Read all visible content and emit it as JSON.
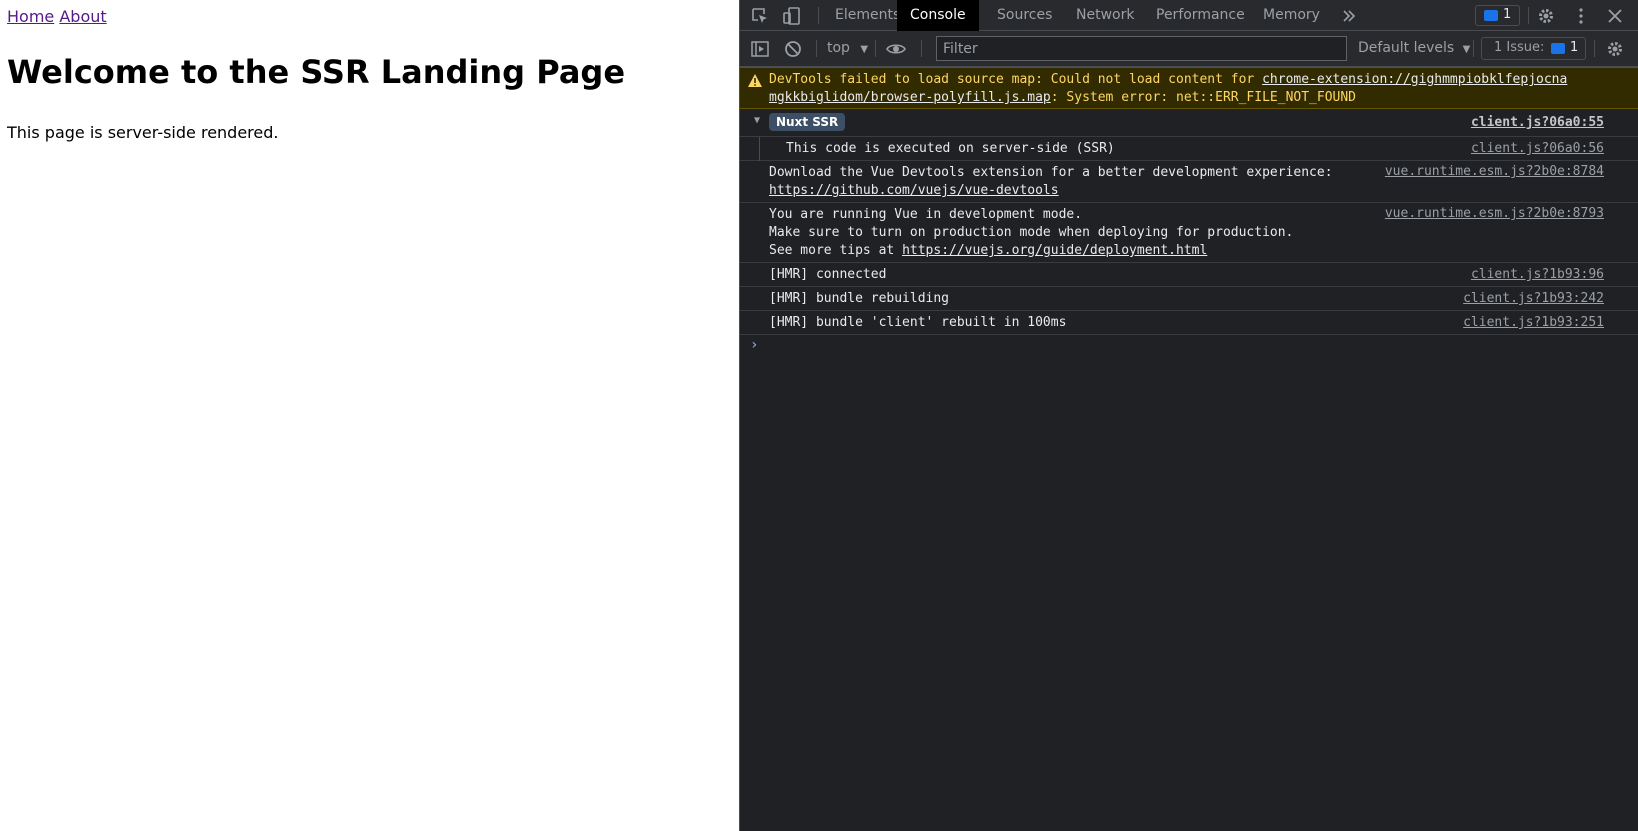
{
  "page": {
    "nav": {
      "home": "Home",
      "about": "About"
    },
    "title": "Welcome to the SSR Landing Page",
    "text": "This page is server-side rendered."
  },
  "devtools": {
    "tabs": [
      "Elements",
      "Console",
      "Sources",
      "Network",
      "Performance",
      "Memory"
    ],
    "active_tab": "Console",
    "issue_count": "1",
    "toolbar": {
      "context": "top",
      "filter_placeholder": "Filter",
      "levels": "Default levels",
      "issues_label": "1 Issue:",
      "issues_count": "1"
    },
    "messages": {
      "warning": {
        "prefix": "DevTools failed to load source map: Could not load content for ",
        "link": "chrome-extension://gighmmpiobklfepjocna\nmgkkbiglidom/browser-polyfill.js.map",
        "suffix": ": System error: net::ERR_FILE_NOT_FOUND"
      },
      "group": {
        "label": "Nuxt SSR",
        "source": "client.js?06a0:55"
      },
      "group_child": {
        "text": "This code is executed on server-side (SSR)",
        "source": "client.js?06a0:56"
      },
      "vue_devtools": {
        "text": "Download the Vue Devtools extension for a better development experience:",
        "link": "https://github.com/vuejs/vue-devtools",
        "source": "vue.runtime.esm.js?2b0e:8784"
      },
      "vue_dev_mode": {
        "line1": "You are running Vue in development mode.",
        "line2": "Make sure to turn on production mode when deploying for production.",
        "line3_prefix": "See more tips at ",
        "link": "https://vuejs.org/guide/deployment.html",
        "source": "vue.runtime.esm.js?2b0e:8793"
      },
      "hmr": [
        {
          "text": "[HMR] connected",
          "source": "client.js?1b93:96"
        },
        {
          "text": "[HMR] bundle rebuilding",
          "source": "client.js?1b93:242"
        },
        {
          "text": "[HMR] bundle 'client' rebuilt in 100ms",
          "source": "client.js?1b93:251"
        }
      ]
    },
    "prompt": "›"
  }
}
